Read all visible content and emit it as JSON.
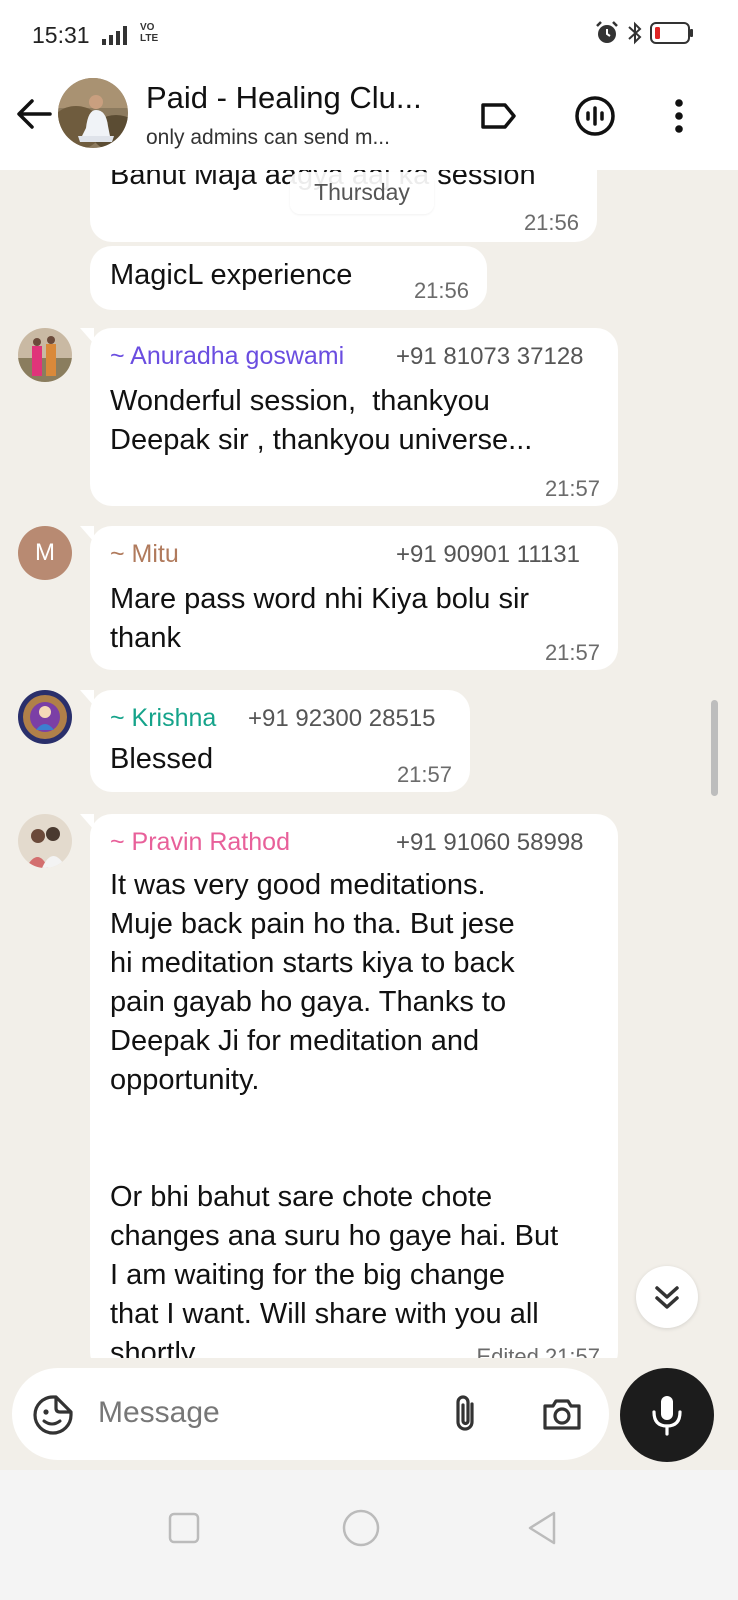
{
  "status_bar": {
    "time": "15:31",
    "network": "VO\nLTE"
  },
  "header": {
    "title": "Paid - Healing Clu...",
    "subtitle": "only admins can send m..."
  },
  "date_chip": "Thursday",
  "messages": [
    {
      "text": "Bahut Maja aagya aaj ka session",
      "time": "21:56"
    },
    {
      "text": "MagicL experience",
      "time": "21:56"
    },
    {
      "sender": "~ Anuradha goswami",
      "phone": "+91 81073 37128",
      "sender_color": "#6a4de0",
      "text": "Wonderful session,  thankyou\nDeepak sir , thankyou universe...",
      "time": "21:57"
    },
    {
      "sender": "~ Mitu",
      "phone": "+91 90901 11131",
      "sender_color": "#b07a5c",
      "avatar_letter": "M",
      "text": "Mare pass word nhi Kiya bolu sir\nthank",
      "time": "21:57"
    },
    {
      "sender": "~ Krishna",
      "phone": "+91 92300 28515",
      "sender_color": "#15a38a",
      "text": "Blessed",
      "time": "21:57"
    },
    {
      "sender": "~ Pravin Rathod",
      "phone": "+91 91060 58998",
      "sender_color": "#e8609a",
      "text": "It was very good meditations.\nMuje back pain ho tha. But jese\nhi meditation starts kiya to back\npain gayab ho gaya. Thanks to\nDeepak Ji for meditation and\nopportunity.\n\n\nOr bhi bahut sare chote chote\nchanges ana suru ho gaye hai. But\nI am waiting for the big change\nthat I want. Will share with you all\nshortly.",
      "time": "Edited 21:57"
    }
  ],
  "input": {
    "placeholder": "Message"
  }
}
